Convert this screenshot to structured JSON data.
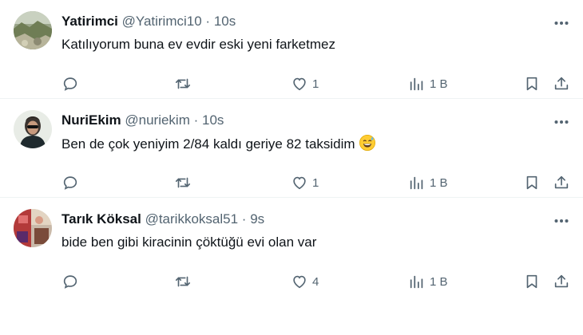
{
  "tweets": [
    {
      "name": "Yatirimci",
      "handle": "@Yatirimci10",
      "time": "10s",
      "text": "Katılıyorum buna ev evdir eski yeni farketmez",
      "likes": "1",
      "views": "1 B",
      "avatar_icon": "landscape-avatar"
    },
    {
      "name": "NuriEkim",
      "handle": "@nuriekim",
      "time": "10s",
      "text": "Ben de çok yeniyim 2/84 kaldı geriye 82 taksidim",
      "emoji": "grinning-face-with-sweat",
      "likes": "1",
      "views": "1 B",
      "avatar_icon": "person-avatar"
    },
    {
      "name": "Tarık Köksal",
      "handle": "@tarikkoksal51",
      "time": "9s",
      "text": "bide ben gibi kiracinin çöktüğü evi olan var",
      "likes": "4",
      "views": "1 B",
      "avatar_icon": "photo-avatar"
    }
  ],
  "separator": "·",
  "colors": {
    "text": "#0f1419",
    "muted": "#536471",
    "border": "#eff3f4"
  }
}
